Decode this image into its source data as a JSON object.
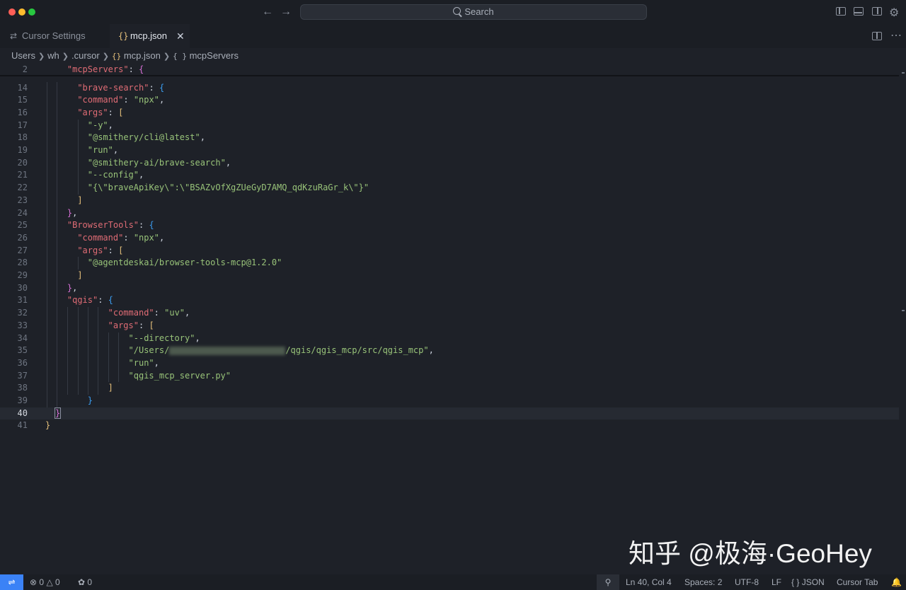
{
  "titlebar": {
    "search_label": "Search",
    "back_icon": "arrow-left-icon",
    "forward_icon": "arrow-right-icon"
  },
  "tabs": [
    {
      "label": "Cursor Settings",
      "icon": "settings-sliders-icon",
      "active": false
    },
    {
      "label": "mcp.json",
      "icon": "json-braces-icon",
      "active": true,
      "close": "✕"
    }
  ],
  "breadcrumb": {
    "items": [
      "Users",
      "wh",
      ".cursor",
      "mcp.json",
      "mcpServers"
    ],
    "json_icon": "{}",
    "object_icon": "{ }"
  },
  "editor": {
    "current_line": 40,
    "lines": [
      {
        "n": "2",
        "text": "  \"mcpServers\": {"
      },
      {
        "n": "14",
        "text": "    \"brave-search\": {"
      },
      {
        "n": "15",
        "text": "    \"command\": \"npx\","
      },
      {
        "n": "16",
        "text": "    \"args\": ["
      },
      {
        "n": "17",
        "text": "      \"-y\","
      },
      {
        "n": "18",
        "text": "      \"@smithery/cli@latest\","
      },
      {
        "n": "19",
        "text": "      \"run\","
      },
      {
        "n": "20",
        "text": "      \"@smithery-ai/brave-search\","
      },
      {
        "n": "21",
        "text": "      \"--config\","
      },
      {
        "n": "22",
        "text": "      \"{\\\"braveApiKey\\\":\\\"BSAZvOfXgZUeGyD7AMQ_qdKzuRaGr_k\\\"}\""
      },
      {
        "n": "23",
        "text": "    ]"
      },
      {
        "n": "24",
        "text": "  },"
      },
      {
        "n": "25",
        "text": "  \"BrowserTools\": {"
      },
      {
        "n": "26",
        "text": "    \"command\": \"npx\","
      },
      {
        "n": "27",
        "text": "    \"args\": ["
      },
      {
        "n": "28",
        "text": "      \"@agentdeskai/browser-tools-mcp@1.2.0\""
      },
      {
        "n": "29",
        "text": "    ]"
      },
      {
        "n": "30",
        "text": "  },"
      },
      {
        "n": "31",
        "text": "  \"qgis\": {"
      },
      {
        "n": "32",
        "text": "    \"command\": \"uv\","
      },
      {
        "n": "33",
        "text": "    \"args\": ["
      },
      {
        "n": "34",
        "text": "      \"--directory\","
      },
      {
        "n": "35",
        "text": "      \"/Users/[redacted]/qgis/qgis_mcp/src/qgis_mcp\","
      },
      {
        "n": "36",
        "text": "      \"run\","
      },
      {
        "n": "37",
        "text": "      \"qgis_mcp_server.py\""
      },
      {
        "n": "38",
        "text": "    ]"
      },
      {
        "n": "39",
        "text": "  }"
      },
      {
        "n": "40",
        "text": "}"
      },
      {
        "n": "41",
        "text": "}"
      }
    ]
  },
  "watermark": "知乎 @极海·GeoHey",
  "statusbar": {
    "remote_icon": "remote-icon",
    "errors": "0",
    "warnings": "0",
    "ports": "0",
    "position": "Ln 40, Col 4",
    "spaces": "Spaces: 2",
    "encoding": "UTF-8",
    "eol": "LF",
    "language": "JSON",
    "language_icon": "{ }",
    "cursor_tab": "Cursor Tab",
    "bell_icon": "bell-icon"
  }
}
